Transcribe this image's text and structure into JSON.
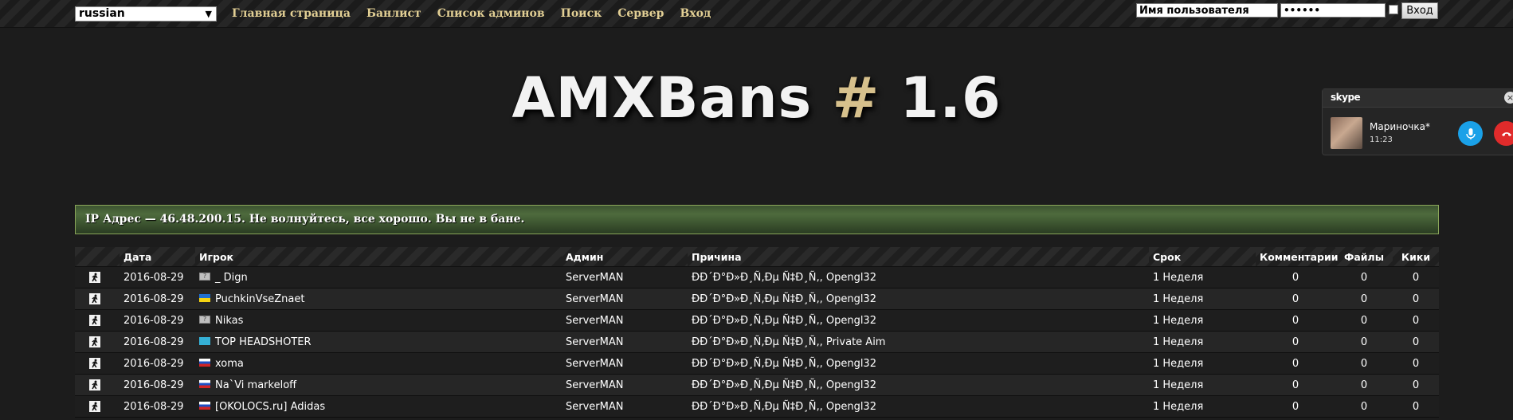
{
  "header": {
    "language": "russian",
    "nav": [
      "Главная страница",
      "Банлист",
      "Список админов",
      "Поиск",
      "Сервер",
      "Вход"
    ],
    "login": {
      "username_value": "Имя пользователя",
      "password_value": "••••••",
      "submit_label": "Вход"
    }
  },
  "logo": {
    "prefix": "AMXBans",
    "hash": "#",
    "version": "1.6"
  },
  "skype": {
    "brand": "skype",
    "contact_name": "Мариночка*",
    "call_time": "11:23",
    "close_glyph": "×"
  },
  "status_message": "IP Адрес — 46.48.200.15. Не волнуйтесь, все хорошо. Вы не в бане.",
  "table": {
    "columns": [
      "",
      "Дата",
      "Игрок",
      "Админ",
      "Причина",
      "Срок",
      "Комментарии",
      "Файлы",
      "Кики"
    ],
    "rows": [
      {
        "date": "2016-08-29",
        "flag": "unknown",
        "player": "_ Dign",
        "admin": "ServerMAN",
        "reason": "ĐĐ´Đ°Đ»Đ¸Ñ‚Đµ Ñ‡Đ¸Ñ‚, Opengl32",
        "term": "1 Неделя",
        "comments": "0",
        "files": "0",
        "kicks": "0"
      },
      {
        "date": "2016-08-29",
        "flag": "ua",
        "player": "PuchkinVseZnaet",
        "admin": "ServerMAN",
        "reason": "ĐĐ´Đ°Đ»Đ¸Ñ‚Đµ Ñ‡Đ¸Ñ‚, Opengl32",
        "term": "1 Неделя",
        "comments": "0",
        "files": "0",
        "kicks": "0"
      },
      {
        "date": "2016-08-29",
        "flag": "unknown",
        "player": "Nikas",
        "admin": "ServerMAN",
        "reason": "ĐĐ´Đ°Đ»Đ¸Ñ‚Đµ Ñ‡Đ¸Ñ‚, Opengl32",
        "term": "1 Неделя",
        "comments": "0",
        "files": "0",
        "kicks": "0"
      },
      {
        "date": "2016-08-29",
        "flag": "kz",
        "player": "TOP HEADSHOTER",
        "admin": "ServerMAN",
        "reason": "ĐĐ´Đ°Đ»Đ¸Ñ‚Đµ Ñ‡Đ¸Ñ‚, Private Aim",
        "term": "1 Неделя",
        "comments": "0",
        "files": "0",
        "kicks": "0"
      },
      {
        "date": "2016-08-29",
        "flag": "ru",
        "player": "xoma",
        "admin": "ServerMAN",
        "reason": "ĐĐ´Đ°Đ»Đ¸Ñ‚Đµ Ñ‡Đ¸Ñ‚, Opengl32",
        "term": "1 Неделя",
        "comments": "0",
        "files": "0",
        "kicks": "0"
      },
      {
        "date": "2016-08-29",
        "flag": "ru",
        "player": "Na`Vi markeloff",
        "admin": "ServerMAN",
        "reason": "ĐĐ´Đ°Đ»Đ¸Ñ‚Đµ Ñ‡Đ¸Ñ‚, Opengl32",
        "term": "1 Неделя",
        "comments": "0",
        "files": "0",
        "kicks": "0"
      },
      {
        "date": "2016-08-29",
        "flag": "ru",
        "player": "[OKOLOCS.ru] Adidas",
        "admin": "ServerMAN",
        "reason": "ĐĐ´Đ°Đ»Đ¸Ñ‚Đµ Ñ‡Đ¸Ñ‚, Opengl32",
        "term": "1 Неделя",
        "comments": "0",
        "files": "0",
        "kicks": "0"
      }
    ]
  },
  "colors": {
    "background": "#1c1c1c",
    "nav_link": "#e2cf94",
    "logo_hash": "#d6c08c",
    "status_border": "#8aa659",
    "skype_mic": "#1aa1e8",
    "skype_end": "#e02b2b"
  },
  "icons": {
    "row_icon": "cs-player-icon",
    "flag_unknown": "unknown-flag-icon",
    "flag_ua": "ukraine-flag-icon",
    "flag_kz": "kazakhstan-flag-icon",
    "flag_ru": "russia-flag-icon"
  }
}
